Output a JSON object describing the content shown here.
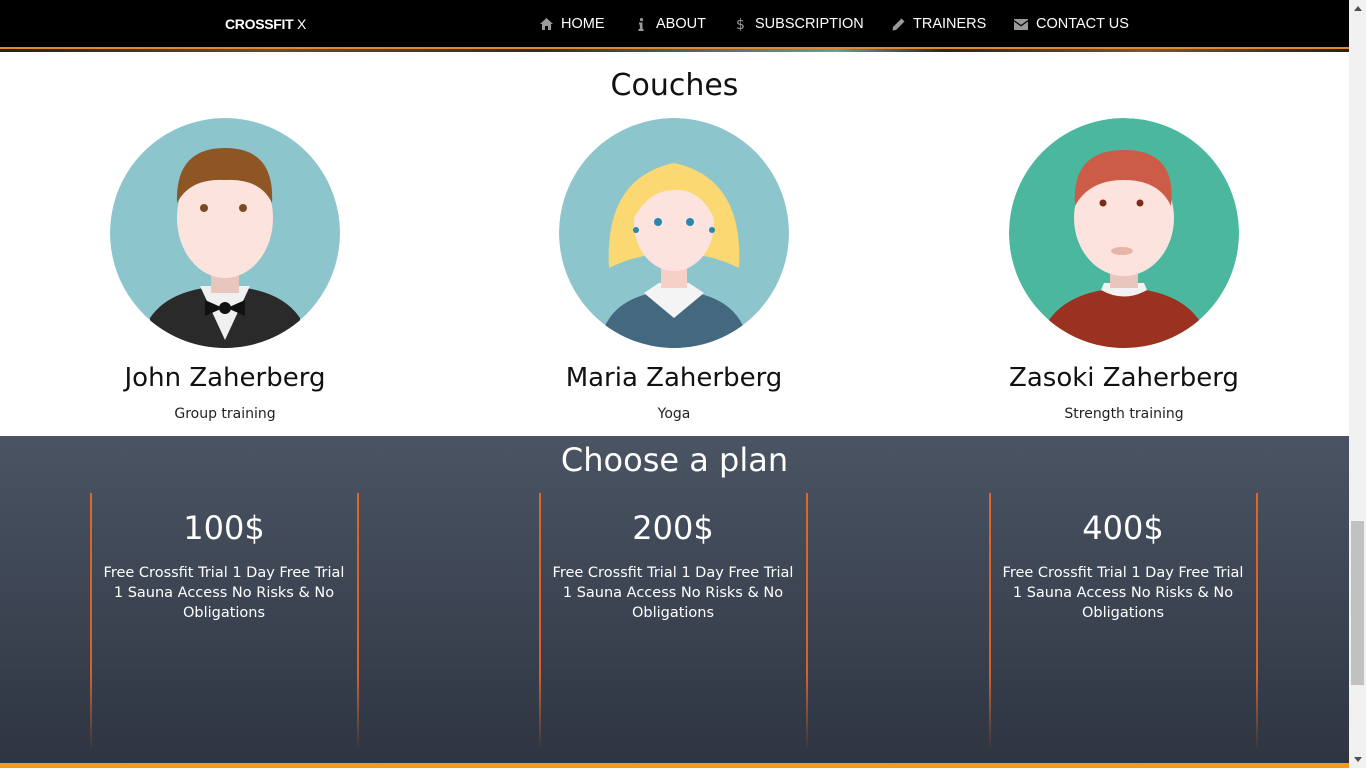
{
  "brand": {
    "bold": "CROSSFIT",
    "rest": " X"
  },
  "nav": [
    {
      "label": "HOME",
      "icon": "home-icon"
    },
    {
      "label": "ABOUT",
      "icon": "info-icon"
    },
    {
      "label": "SUBSCRIPTION",
      "icon": "dollar-icon"
    },
    {
      "label": "TRAINERS",
      "icon": "pencil-icon"
    },
    {
      "label": "CONTACT US",
      "icon": "envelope-icon"
    }
  ],
  "coaches": {
    "title": "Couches",
    "items": [
      {
        "name": "John Zaherberg",
        "role": "Group training"
      },
      {
        "name": "Maria Zaherberg",
        "role": "Yoga"
      },
      {
        "name": "Zasoki Zaherberg",
        "role": "Strength training"
      }
    ]
  },
  "plans": {
    "title": "Choose a plan",
    "items": [
      {
        "price": "100$",
        "desc": "Free Crossfit Trial 1 Day Free Trial 1 Sauna Access No Risks & No Obligations"
      },
      {
        "price": "200$",
        "desc": "Free Crossfit Trial 1 Day Free Trial 1 Sauna Access No Risks & No Obligations"
      },
      {
        "price": "400$",
        "desc": "Free Crossfit Trial 1 Day Free Trial 1 Sauna Access No Risks & No Obligations"
      }
    ]
  },
  "colors": {
    "navbar": "#000000",
    "accent": "#e0652a",
    "plans_bg": "#3b4351",
    "bottom_bar": "#f39a1e"
  }
}
